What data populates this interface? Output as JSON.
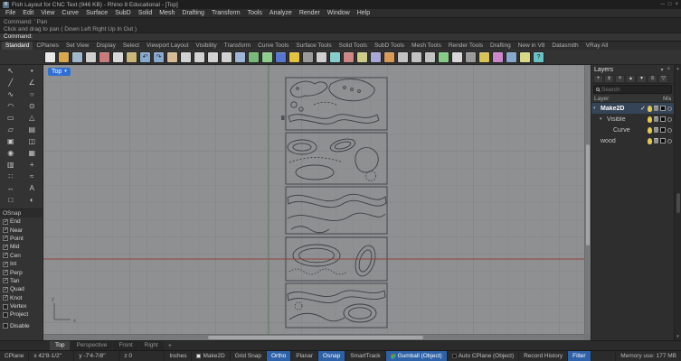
{
  "colors": {
    "accent_blue": "#2f6fd4",
    "status_on_blue": "#2e62a8",
    "viewport_bg": "#8e9092",
    "x_axis_red": "#94423c",
    "y_axis_green": "#5d7a57",
    "drawing_stroke": "#3c3f42"
  },
  "window": {
    "logo": "R",
    "title": "Fish Layout for CNC Text (946 KB) - Rhino 8 Educational - [Top]",
    "minimize": "─",
    "maximize": "□",
    "close": "×"
  },
  "menubar": {
    "items": [
      "File",
      "Edit",
      "View",
      "Curve",
      "Surface",
      "SubD",
      "Solid",
      "Mesh",
      "Drafting",
      "Transform",
      "Tools",
      "Analyze",
      "Render",
      "Window",
      "Help"
    ]
  },
  "command": {
    "history_1": "Command: ' Pan",
    "history_2": "Click and drag to pan ( Down  Left  Right  Up  In  Out )",
    "prompt": "Command:"
  },
  "toolbar_tabs": {
    "items": [
      {
        "label": "Standard",
        "cls": "active"
      },
      {
        "label": "CPlanes"
      },
      {
        "label": "Set View"
      },
      {
        "label": "Display"
      },
      {
        "label": "Select"
      },
      {
        "label": "Viewport Layout"
      },
      {
        "label": "Visibility"
      },
      {
        "label": "Transform"
      },
      {
        "label": "Curve Tools"
      },
      {
        "label": "Surface Tools"
      },
      {
        "label": "Solid Tools"
      },
      {
        "label": "SubD Tools"
      },
      {
        "label": "Mesh Tools"
      },
      {
        "label": "Render Tools"
      },
      {
        "label": "Drafting"
      },
      {
        "label": "New in V8"
      },
      {
        "label": "Datasmith"
      },
      {
        "label": "VRay All"
      }
    ]
  },
  "toolbar_icons": [
    {
      "n": "new-file-icon",
      "c": "#e9e9e9",
      "g": ""
    },
    {
      "n": "open-file-icon",
      "c": "#d9a84b",
      "g": ""
    },
    {
      "n": "save-icon",
      "c": "#9fb6cc",
      "g": ""
    },
    {
      "n": "print-icon",
      "c": "#cfcfcf",
      "g": ""
    },
    {
      "n": "cut-icon",
      "c": "#c97b7b",
      "g": ""
    },
    {
      "n": "copy-icon",
      "c": "#d8d8d8",
      "g": ""
    },
    {
      "n": "paste-icon",
      "c": "#c9b679",
      "g": ""
    },
    {
      "n": "undo-icon",
      "c": "#88a8cc",
      "g": "↶"
    },
    {
      "n": "redo-icon",
      "c": "#88a8cc",
      "g": "↷"
    },
    {
      "n": "pan-icon",
      "c": "#d8bb96",
      "g": ""
    },
    {
      "n": "zoom-dynamic-icon",
      "c": "#d2d2d2",
      "g": ""
    },
    {
      "n": "zoom-window-icon",
      "c": "#d2d2d2",
      "g": ""
    },
    {
      "n": "zoom-extents-icon",
      "c": "#d2d2d2",
      "g": ""
    },
    {
      "n": "zoom-selected-icon",
      "c": "#d2d2d2",
      "g": ""
    },
    {
      "n": "undo-view-icon",
      "c": "#9db4d6",
      "g": ""
    },
    {
      "n": "viewport-layout-icon",
      "c": "#79b879",
      "g": ""
    },
    {
      "n": "shaded-view-icon",
      "c": "#8fcc8f",
      "g": ""
    },
    {
      "n": "render-icon",
      "c": "#5577cc",
      "g": ""
    },
    {
      "n": "sun-icon",
      "c": "#e3c23e",
      "g": ""
    },
    {
      "n": "grid-icon",
      "c": "#9a9a9a",
      "g": ""
    },
    {
      "n": "move-icon",
      "c": "#cfcfcf",
      "g": ""
    },
    {
      "n": "rotate-icon",
      "c": "#86cccc",
      "g": ""
    },
    {
      "n": "scale-icon",
      "c": "#cc8686",
      "g": ""
    },
    {
      "n": "mirror-icon",
      "c": "#cccc86",
      "g": ""
    },
    {
      "n": "join-icon",
      "c": "#a8a8d8",
      "g": ""
    },
    {
      "n": "explode-icon",
      "c": "#d89a55",
      "g": ""
    },
    {
      "n": "trim-icon",
      "c": "#c2c2c2",
      "g": ""
    },
    {
      "n": "split-icon",
      "c": "#c2c2c2",
      "g": ""
    },
    {
      "n": "offset-icon",
      "c": "#c2c2c2",
      "g": ""
    },
    {
      "n": "fillet-icon",
      "c": "#86cc86",
      "g": ""
    },
    {
      "n": "group-icon",
      "c": "#d8d8d8",
      "g": ""
    },
    {
      "n": "hide-icon",
      "c": "#9a9a9a",
      "g": ""
    },
    {
      "n": "lock-icon",
      "c": "#d8c455",
      "g": ""
    },
    {
      "n": "layers-icon",
      "c": "#cc86cc",
      "g": ""
    },
    {
      "n": "properties-icon",
      "c": "#86a8cc",
      "g": ""
    },
    {
      "n": "notes-icon",
      "c": "#d8d886",
      "g": ""
    },
    {
      "n": "help-icon",
      "c": "#66c2c2",
      "g": "?"
    }
  ],
  "sidebar_tools": [
    {
      "n": "pointer-tool",
      "g": "↖"
    },
    {
      "n": "point-tool",
      "g": "•"
    },
    {
      "n": "line-tool",
      "g": "╱"
    },
    {
      "n": "polyline-tool",
      "g": "∠"
    },
    {
      "n": "curve-tool",
      "g": "∿"
    },
    {
      "n": "circle-tool",
      "g": "○"
    },
    {
      "n": "arc-tool",
      "g": "◠"
    },
    {
      "n": "ellipse-tool",
      "g": "⊙"
    },
    {
      "n": "rectangle-tool",
      "g": "▭"
    },
    {
      "n": "polygon-tool",
      "g": "△"
    },
    {
      "n": "surface-tool",
      "g": "▱"
    },
    {
      "n": "surface-tools-icon",
      "g": "▤"
    },
    {
      "n": "solid-tool",
      "g": "▣"
    },
    {
      "n": "solid-tools-icon",
      "g": "◫"
    },
    {
      "n": "subd-tool",
      "g": "◉"
    },
    {
      "n": "mesh-tool",
      "g": "▦"
    },
    {
      "n": "mesh-tools-icon",
      "g": "▥"
    },
    {
      "n": "transform-tool",
      "g": "+"
    },
    {
      "n": "array-tool",
      "g": "∷"
    },
    {
      "n": "analyze-tool",
      "g": "≈"
    },
    {
      "n": "dimension-tool",
      "g": "↔"
    },
    {
      "n": "text-tool",
      "g": "A"
    },
    {
      "n": "block-tool",
      "g": "□"
    },
    {
      "n": "visibility-tool",
      "g": "◐"
    }
  ],
  "osnap": {
    "title": "OSnap",
    "items": [
      {
        "label": "End",
        "cls": "checked"
      },
      {
        "label": "Near",
        "cls": "checked"
      },
      {
        "label": "Point",
        "cls": "checked"
      },
      {
        "label": "Mid",
        "cls": "checked"
      },
      {
        "label": "Cen",
        "cls": "checked"
      },
      {
        "label": "Int",
        "cls": "checked"
      },
      {
        "label": "Perp",
        "cls": "checked"
      },
      {
        "label": "Tan",
        "cls": "checked"
      },
      {
        "label": "Quad",
        "cls": "checked"
      },
      {
        "label": "Knot",
        "cls": "checked"
      },
      {
        "label": "Vertex",
        "cls": ""
      },
      {
        "label": "Project",
        "cls": ""
      }
    ],
    "disable": {
      "label": "Disable"
    }
  },
  "viewport": {
    "label": "Top",
    "caret": "▾"
  },
  "layers_panel": {
    "title": "Layers",
    "menu_icons": [
      {
        "n": "panel-menu-icon",
        "g": "▾"
      },
      {
        "n": "close-panel-icon",
        "g": "×"
      }
    ],
    "tool_icons": [
      {
        "n": "new-layer-icon",
        "g": "+"
      },
      {
        "n": "new-sublayer-icon",
        "g": "±"
      },
      {
        "n": "delete-layer-icon",
        "g": "×"
      },
      {
        "n": "move-layer-up-icon",
        "g": "▴"
      },
      {
        "n": "move-layer-down-icon",
        "g": "▾"
      },
      {
        "n": "layer-menu-icon",
        "g": "≡"
      },
      {
        "n": "filter-layers-icon",
        "g": "▽"
      }
    ],
    "search_placeholder": "Search",
    "columns": {
      "name": "Layer",
      "material": "Ma"
    },
    "current_check": "✓",
    "rows": [
      {
        "name": "Make2D",
        "arrow": "▾",
        "cls": "i0 current"
      },
      {
        "name": "Visible",
        "arrow": "▾",
        "cls": "i1"
      },
      {
        "name": "Curve",
        "arrow": "",
        "cls": "i2"
      },
      {
        "name": "wood",
        "arrow": "",
        "cls": "i0"
      }
    ]
  },
  "viewport_tabs": {
    "items": [
      {
        "label": "Top",
        "cls": "active"
      },
      {
        "label": "Perspective"
      },
      {
        "label": "Front"
      },
      {
        "label": "Right"
      }
    ],
    "new_tab_label": "+"
  },
  "status": {
    "items": [
      {
        "label": "CPlane",
        "cls": "plain"
      },
      {
        "label": "x 42'8-1/2\"",
        "cls": "coord"
      },
      {
        "label": "y -7'4-7/8\"",
        "cls": "coord"
      },
      {
        "label": "z 0",
        "cls": "coord"
      },
      {
        "label": "Inches",
        "cls": "plain"
      },
      {
        "label": "Make2D",
        "cls": "check"
      },
      {
        "label": "Grid Snap",
        "cls": "toggle"
      },
      {
        "label": "Ortho",
        "cls": "toggle on"
      },
      {
        "label": "Planar",
        "cls": "toggle"
      },
      {
        "label": "Osnap",
        "cls": "toggle on"
      },
      {
        "label": "SmartTrack",
        "cls": "toggle"
      },
      {
        "label": "Gumball (Object)",
        "cls": "toggle on gumball"
      },
      {
        "label": "Auto CPlane (Object)",
        "cls": "check dark"
      },
      {
        "label": "Record History",
        "cls": "toggle"
      },
      {
        "label": "Filter",
        "cls": "toggle on"
      },
      {
        "label": "Memory use: 177 MB",
        "cls": "mem"
      }
    ]
  }
}
